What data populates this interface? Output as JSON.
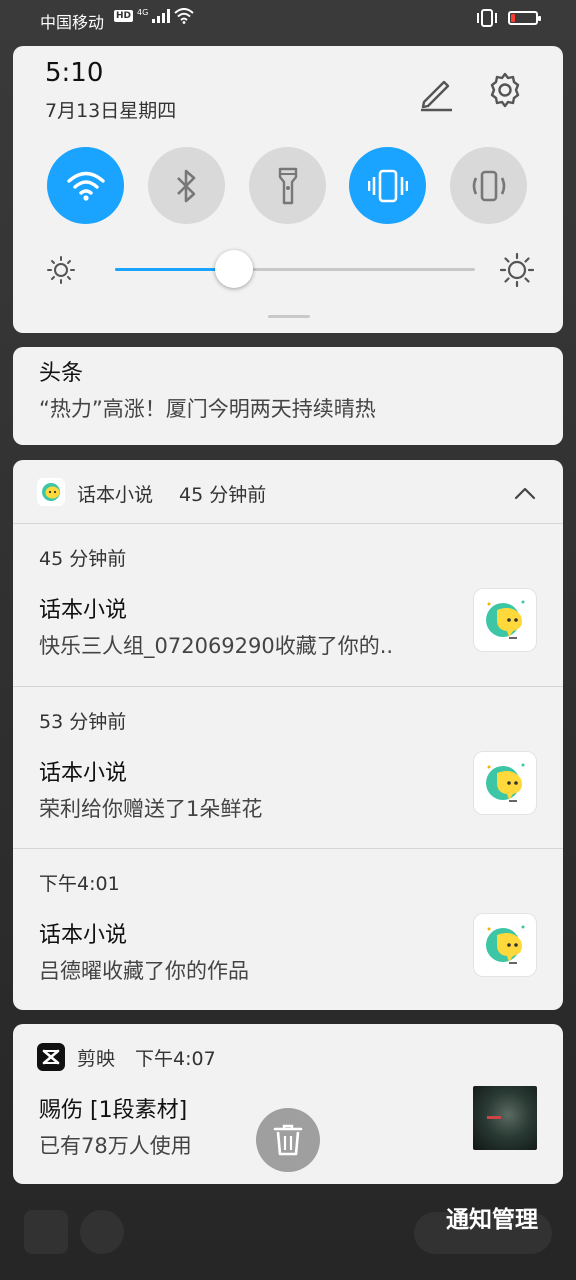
{
  "status_bar": {
    "carrier": "中国移动",
    "hd_badge": "HD",
    "network": "4G"
  },
  "quick_settings": {
    "time": "5:10",
    "date": "7月13日星期四",
    "toggles": [
      {
        "name": "wifi",
        "on": true
      },
      {
        "name": "bluetooth",
        "on": false
      },
      {
        "name": "flashlight",
        "on": false
      },
      {
        "name": "vibrate",
        "on": true
      },
      {
        "name": "auto-rotate",
        "on": false
      }
    ],
    "brightness_level": 0.33,
    "accent_color": "#1aa3ff"
  },
  "headline": {
    "title": "头条",
    "body": "“热力”高涨！厦门今明两天持续晴热"
  },
  "huaben": {
    "app_name": "话本小说",
    "time": "45 分钟前",
    "items": [
      {
        "time": "45 分钟前",
        "title": "话本小说",
        "body": "快乐三人组_072069290收藏了你的.."
      },
      {
        "time": "53 分钟前",
        "title": "话本小说",
        "body": "荣利给你赠送了1朵鲜花"
      },
      {
        "time": "下午4:01",
        "title": "话本小说",
        "body": "吕德曜收藏了你的作品"
      }
    ]
  },
  "jianying": {
    "app_name": "剪映",
    "time": "下午4:07",
    "title": "赐伤 [1段素材]",
    "body": "已有78万人使用"
  },
  "footer": {
    "manage_label": "通知管理"
  }
}
